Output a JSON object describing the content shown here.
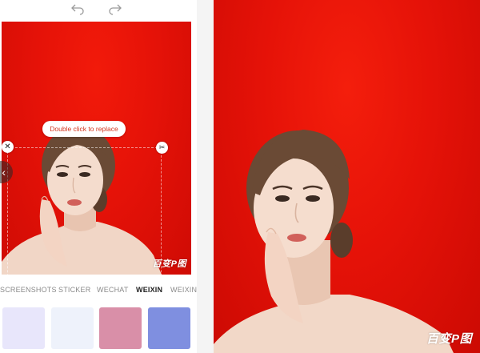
{
  "editor": {
    "hint": "Double click to replace",
    "watermark": "百变P图"
  },
  "tabs": [
    {
      "label": "SCREENSHOTS",
      "active": false
    },
    {
      "label": "STICKER",
      "active": false
    },
    {
      "label": "WECHAT",
      "active": false
    },
    {
      "label": "WEIXIN",
      "active": true
    },
    {
      "label": "WEIXIN",
      "active": false
    }
  ],
  "swatches": [
    {
      "color": "#e8e6fb"
    },
    {
      "color": "#eef2fb"
    },
    {
      "color": "#d98fa8"
    },
    {
      "color": "#7f8fe0"
    }
  ],
  "preview": {
    "watermark": "百变P图"
  },
  "colors": {
    "background_red": "#e51208",
    "accent": "#d3361f"
  }
}
